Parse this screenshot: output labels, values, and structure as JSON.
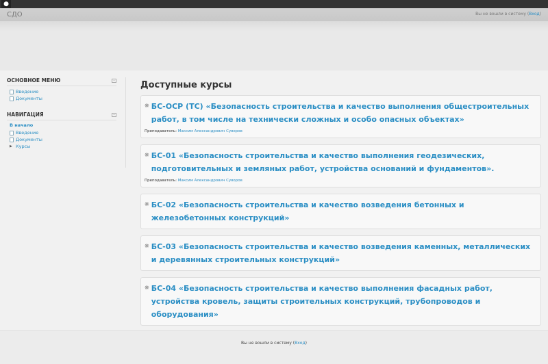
{
  "header": {
    "brand": "СДО",
    "login_text": "Вы не вошли в систему",
    "login_link": "Вход"
  },
  "sidebar": {
    "main_menu": {
      "title": "ОСНОВНОЕ МЕНЮ",
      "items": [
        {
          "label": "Введение"
        },
        {
          "label": "Документы"
        }
      ]
    },
    "navigation": {
      "title": "НАВИГАЦИЯ",
      "home": "В начало",
      "items": [
        {
          "label": "Введение"
        },
        {
          "label": "Документы"
        },
        {
          "label": "Курсы"
        }
      ]
    }
  },
  "main": {
    "title": "Доступные курсы",
    "teacher_label": "Преподаватель:",
    "courses": [
      {
        "title": "БС-ОСР (ТС) «Безопасность строительства и качество выполнения общестроительных работ, в том числе на технически сложных и особо опасных объектах»",
        "teacher": "Максим Александрович Суворов"
      },
      {
        "title": "БС-01 «Безопасность строительства и качество выполнения геодезических, подготовительных и земляных работ, устройства оснований и фундаментов».",
        "teacher": "Максим Александрович Суворов"
      },
      {
        "title": "БС-02 «Безопасность строительства и качество возведения бетонных и железобетонных конструкций»"
      },
      {
        "title": "БС-03 «Безопасность строительства и качество возведения каменных, металлических и деревянных строительных конструкций»"
      },
      {
        "title": "БС-04 «Безопасность строительства и качество выполнения фасадных работ, устройства кровель, защиты строительных конструкций, трубопроводов и оборудования»"
      }
    ]
  },
  "footer": {
    "login_text": "Вы не вошли в систему",
    "login_link": "Вход"
  }
}
